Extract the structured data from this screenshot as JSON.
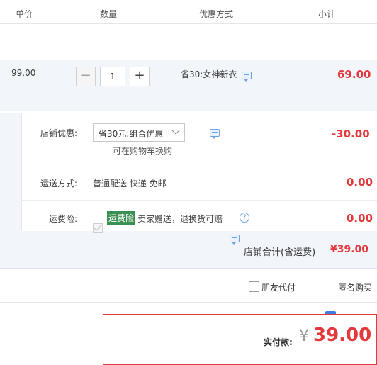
{
  "header": {
    "col_unit_price": "单价",
    "col_quantity": "数量",
    "col_promo": "优惠方式",
    "col_subtotal": "小计"
  },
  "item": {
    "unit_price": "99.00",
    "quantity": "1",
    "minus_symbol": "−",
    "plus_symbol": "+",
    "promo": "省30:女神新衣",
    "subtotal": "69.00"
  },
  "shop": {
    "discount_label": "店铺优惠:",
    "discount_selected": "省30元:组合优惠",
    "discount_hint": "可在购物车换购",
    "discount_value": "-30.00",
    "shipping_label": "运送方式:",
    "shipping_text": "普通配送 快递 免邮",
    "shipping_value": "0.00",
    "insurance_label": "运费险:",
    "insurance_tag": "运费险",
    "insurance_text": "卖家赠送，退换货可赔",
    "insurance_value": "0.00",
    "total_label": "店铺合计(含运费)",
    "total_value": "¥39.00"
  },
  "options": {
    "friend_pay": "朋友代付",
    "anonymous": "匿名购买"
  },
  "payment": {
    "label": "实付款:",
    "currency": "¥",
    "amount": "39.00"
  },
  "colors": {
    "accent_red": "#e4393c",
    "checkbox_blue": "#3d7ee0",
    "insurance_green": "#3a8f52"
  },
  "icons": [
    "comment-icon",
    "question-icon",
    "chevron-down-icon",
    "checkmark-icon"
  ]
}
